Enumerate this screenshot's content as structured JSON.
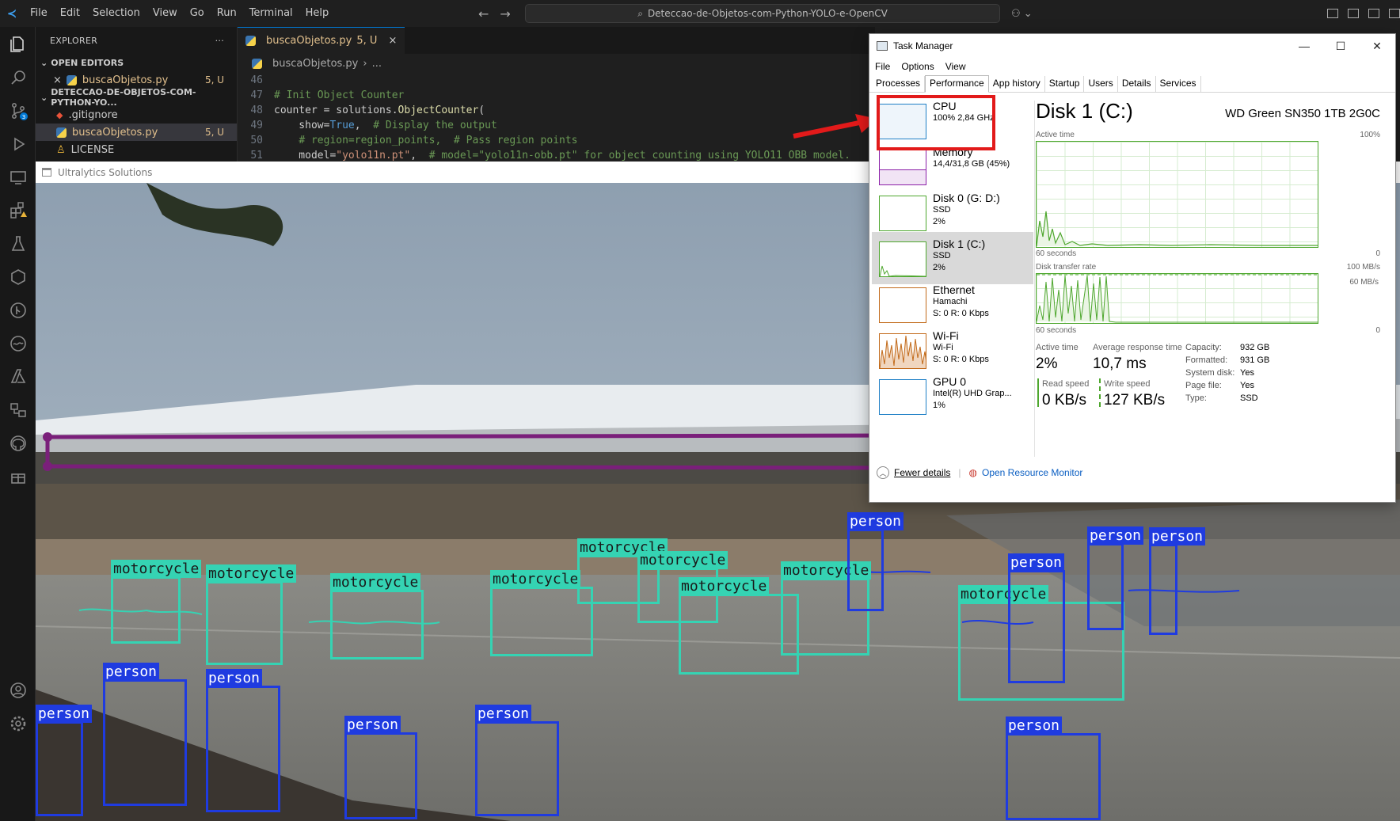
{
  "menu": [
    "File",
    "Edit",
    "Selection",
    "View",
    "Go",
    "Run",
    "Terminal",
    "Help"
  ],
  "command_center": "Deteccao-de-Objetos-com-Python-YOLO-e-OpenCV",
  "explorer": {
    "title": "EXPLORER",
    "more": "···",
    "open_editors": "OPEN EDITORS",
    "open_file": {
      "name": "buscaObjetos.py",
      "badge": "5, U"
    },
    "project": "DETECCAO-DE-OBJETOS-COM-PYTHON-YO...",
    "files": [
      {
        "name": ".gitignore",
        "badge": ""
      },
      {
        "name": "buscaObjetos.py",
        "badge": "5, U"
      },
      {
        "name": "LICENSE",
        "badge": ""
      }
    ]
  },
  "editor": {
    "tab": {
      "name": "buscaObjetos.py",
      "badge": "5, U"
    },
    "breadcrumb": [
      "buscaObjetos.py",
      "..."
    ],
    "lines": [
      {
        "n": "46",
        "html": ""
      },
      {
        "n": "47",
        "html": "<span class='cm'># Init Object Counter</span>"
      },
      {
        "n": "48",
        "html": "counter = solutions.<span class='fn'>ObjectCounter</span>("
      },
      {
        "n": "49",
        "html": "    show=<span class='kw'>True</span>,  <span class='cm'># Display the output</span>"
      },
      {
        "n": "50",
        "html": "    <span class='cm'># region=region_points,  # Pass region points</span>"
      },
      {
        "n": "51",
        "html": "    model=<span class='st'>\"yolo11n.pt\"</span>,  <span class='cm'># model=\"yolo11n-obb.pt\" for object counting using YOLO11 OBB model.</span>"
      }
    ]
  },
  "ultralytics_window_title": "Ultralytics Solutions",
  "detections": [
    {
      "label": "motorcycle",
      "type": "m"
    },
    {
      "label": "motorcycle",
      "type": "m"
    },
    {
      "label": "motorcycle",
      "type": "m"
    },
    {
      "label": "motorcycle",
      "type": "m"
    },
    {
      "label": "motorcycle",
      "type": "m"
    },
    {
      "label": "motorcycle",
      "type": "m"
    },
    {
      "label": "motorcycle",
      "type": "m"
    },
    {
      "label": "motorcycle",
      "type": "m"
    },
    {
      "label": "motorcycle",
      "type": "m"
    },
    {
      "label": "person",
      "type": "p"
    },
    {
      "label": "person",
      "type": "p"
    },
    {
      "label": "person",
      "type": "p"
    },
    {
      "label": "person",
      "type": "p"
    },
    {
      "label": "person",
      "type": "p"
    },
    {
      "label": "person",
      "type": "p"
    },
    {
      "label": "person",
      "type": "p"
    },
    {
      "label": "person",
      "type": "p"
    },
    {
      "label": "person",
      "type": "p"
    },
    {
      "label": "person",
      "type": "p"
    }
  ],
  "task_manager": {
    "title": "Task Manager",
    "menu": [
      "File",
      "Options",
      "View"
    ],
    "tabs": [
      "Processes",
      "Performance",
      "App history",
      "Startup",
      "Users",
      "Details",
      "Services"
    ],
    "active_tab": "Performance",
    "resources": [
      {
        "name": "CPU",
        "sub1": "100%  2,84 GHz",
        "sub2": "",
        "sub3": ""
      },
      {
        "name": "Memory",
        "sub1": "14,4/31,8 GB (45%)",
        "sub2": "",
        "sub3": ""
      },
      {
        "name": "Disk 0 (G: D:)",
        "sub1": "SSD",
        "sub2": "2%",
        "sub3": ""
      },
      {
        "name": "Disk 1 (C:)",
        "sub1": "SSD",
        "sub2": "2%",
        "sub3": ""
      },
      {
        "name": "Ethernet",
        "sub1": "Hamachi",
        "sub2": "S: 0  R: 0 Kbps",
        "sub3": ""
      },
      {
        "name": "Wi-Fi",
        "sub1": "Wi-Fi",
        "sub2": "S: 0  R: 0 Kbps",
        "sub3": ""
      },
      {
        "name": "GPU 0",
        "sub1": "Intel(R) UHD Grap...",
        "sub2": "1%",
        "sub3": ""
      }
    ],
    "selected_resource": "Disk 1 (C:)",
    "detail": {
      "heading": "Disk 1 (C:)",
      "model": "WD Green SN350 1TB 2G0C",
      "active_time_label": "Active time",
      "active_time_max": "100%",
      "seconds_label": "60 seconds",
      "zero": "0",
      "transfer_label": "Disk transfer rate",
      "transfer_max": "100 MB/s",
      "transfer_mid": "60 MB/s",
      "stats": {
        "active_time": {
          "label": "Active time",
          "value": "2%"
        },
        "avg_response": {
          "label": "Average response time",
          "value": "10,7 ms"
        },
        "read_speed": {
          "label": "Read speed",
          "value": "0 KB/s"
        },
        "write_speed": {
          "label": "Write speed",
          "value": "127 KB/s"
        }
      },
      "props": [
        {
          "k": "Capacity:",
          "v": "932 GB"
        },
        {
          "k": "Formatted:",
          "v": "931 GB"
        },
        {
          "k": "System disk:",
          "v": "Yes"
        },
        {
          "k": "Page file:",
          "v": "Yes"
        },
        {
          "k": "Type:",
          "v": "SSD"
        }
      ]
    },
    "fewer_details": "Fewer details",
    "open_resource_monitor": "Open Resource Monitor"
  },
  "colors": {
    "annotation": "#e21a1a",
    "motorcycle_box": "#35d3b3",
    "person_box": "#1f3be0",
    "region_line": "#7a1f7a",
    "disk_graph": "#4ea72e"
  }
}
